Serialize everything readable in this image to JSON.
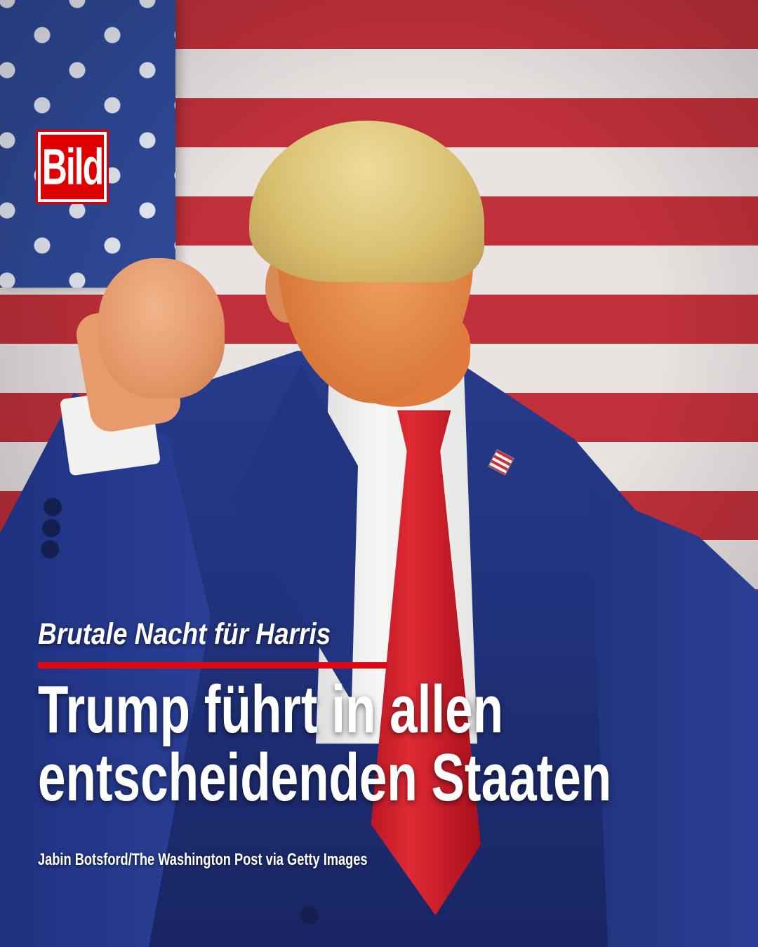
{
  "brand": {
    "logo_text": "Bild",
    "logo_color": "#de0000"
  },
  "photo": {
    "description_icon": "photo-person-fist-raised"
  },
  "article": {
    "kicker": "Brutale Nacht für Harris",
    "headline_line1": "Trump führt in allen",
    "headline_line2": "entscheidenden Staaten",
    "photo_credit": "Jabin Botsford/The Washington Post via Getty Images"
  },
  "colors": {
    "accent_rule": "#e30613",
    "headline_text": "#ffffff"
  }
}
